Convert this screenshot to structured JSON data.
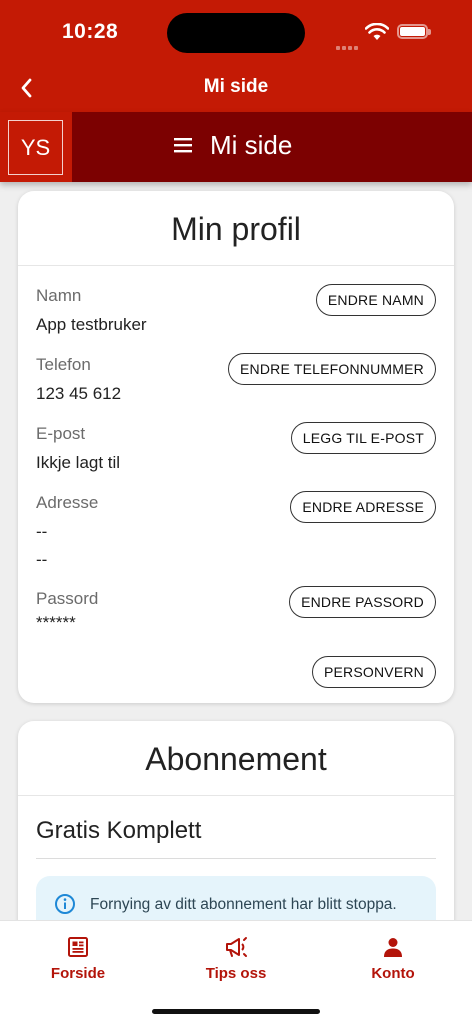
{
  "status": {
    "time": "10:28"
  },
  "nav": {
    "title": "Mi side"
  },
  "site": {
    "logo": "YS",
    "title": "Mi side"
  },
  "profile": {
    "title": "Min profil",
    "fields": [
      {
        "label": "Namn",
        "value": "App testbruker",
        "button": "ENDRE NAMN"
      },
      {
        "label": "Telefon",
        "value": "123 45 612",
        "button": "ENDRE TELEFONNUMMER"
      },
      {
        "label": "E-post",
        "value": "Ikkje lagt til",
        "button": "LEGG TIL E-POST"
      },
      {
        "label": "Adresse",
        "value": "--",
        "value2": "--",
        "button": "ENDRE ADRESSE"
      },
      {
        "label": "Passord",
        "value": "******",
        "button": "ENDRE PASSORD"
      }
    ],
    "privacy_button": "PERSONVERN"
  },
  "subscription": {
    "title": "Abonnement",
    "plan": "Gratis Komplett",
    "notice": "Fornying av ditt abonnement har blitt stoppa."
  },
  "tabs": [
    {
      "label": "Forside",
      "icon": "newspaper-icon"
    },
    {
      "label": "Tips oss",
      "icon": "megaphone-icon"
    },
    {
      "label": "Konto",
      "icon": "person-icon"
    }
  ],
  "colors": {
    "brand": "#c41a05",
    "header_dark": "#7c0101",
    "tab_active": "#b3140a",
    "notice_bg": "#e5f4fb"
  }
}
